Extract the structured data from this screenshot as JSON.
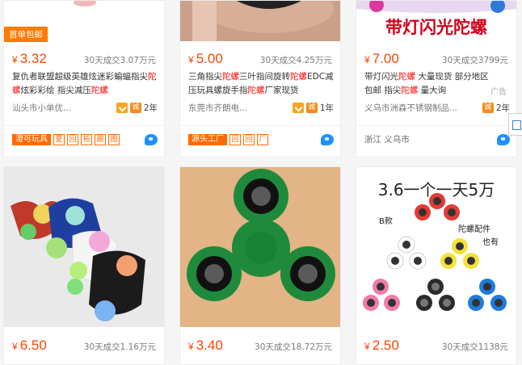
{
  "colors": {
    "price": "#ff4400",
    "highlight": "#ff0000",
    "tag": "#ff6a00"
  },
  "cards": [
    {
      "first_order_tag": "首单包邮",
      "price_symbol": "¥",
      "price": "3.32",
      "sales": "30天成交3.07万元",
      "title_parts": [
        "复仇者联盟超级英雄炫迷彩蝙蝠指尖",
        "陀螺",
        "炫彩彩绘 指尖减压",
        "陀螺"
      ],
      "shop": "汕头市小单优...",
      "years": "2年",
      "tags": [
        "澄可玩具",
        "夏",
        "回",
        "拓",
        "跟",
        "图"
      ],
      "wangwang_icon": "wangwang-chat-icon"
    },
    {
      "price_symbol": "¥",
      "price": "5.00",
      "sales": "30天成交4.25万元",
      "title_parts": [
        "三角指尖",
        "陀螺",
        "三叶指间旋转",
        "陀螺",
        "EDC减压玩具螺旋手指",
        "陀螺",
        "厂家现货"
      ],
      "shop": "东莞市齐朗电...",
      "years": "1年",
      "tags": [
        "源头工厂",
        "回",
        "回",
        "厂"
      ],
      "wangwang_icon": "wangwang-chat-icon"
    },
    {
      "image_banner": "带灯闪光陀螺",
      "price_symbol": "¥",
      "price": "7.00",
      "sales": "30天成交3799元",
      "title_parts": [
        "带灯闪光",
        "陀螺",
        " 大量现货 部分地区包邮 指尖",
        "陀螺",
        " 量大询"
      ],
      "ad_label": "广告",
      "shop": "义乌市洲森不锈钢制品...",
      "years": "2年",
      "location": "浙江 义乌市",
      "wangwang_icon": "wangwang-chat-icon"
    },
    {
      "price_symbol": "¥",
      "price": "6.50",
      "sales": "30天成交1.16万元"
    },
    {
      "price_symbol": "¥",
      "price": "3.40",
      "sales": "30天成交18.72万元"
    },
    {
      "image_caption_top": "3.6一个一天5万",
      "image_label_b": "B款",
      "image_label_parts": "陀螺配件",
      "image_label_also": "也有",
      "price_symbol": "¥",
      "price": "2.50",
      "sales": "30天成交1138元"
    }
  ]
}
